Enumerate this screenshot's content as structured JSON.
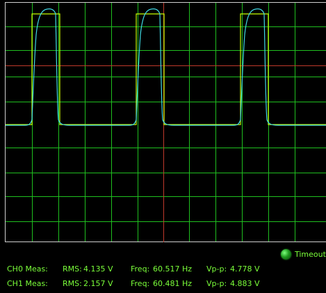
{
  "colors": {
    "grid": "#1fbf1f",
    "frame": "#cfcfcf",
    "cursor": "#c0392b",
    "ch0_trace": "#c8ff00",
    "ch1_trace": "#40d9e6",
    "text": "#7bff3a"
  },
  "status": {
    "timeout_label": "Timeout",
    "timeout_led_icon": "led-indicator-icon"
  },
  "measurements": [
    {
      "channel": "CH0 Meas:",
      "rms_label": "RMS:",
      "rms": "4.135 V",
      "freq_label": "Freq:",
      "freq": "60.517 Hz",
      "vpp_label": "Vp-p:",
      "vpp": "4.778 V"
    },
    {
      "channel": "CH1 Meas:",
      "rms_label": "RMS:",
      "rms": "2.157 V",
      "freq_label": "Freq:",
      "freq": "60.481 Hz",
      "vpp_label": "Vp-p:",
      "vpp": "4.883 V"
    }
  ]
}
